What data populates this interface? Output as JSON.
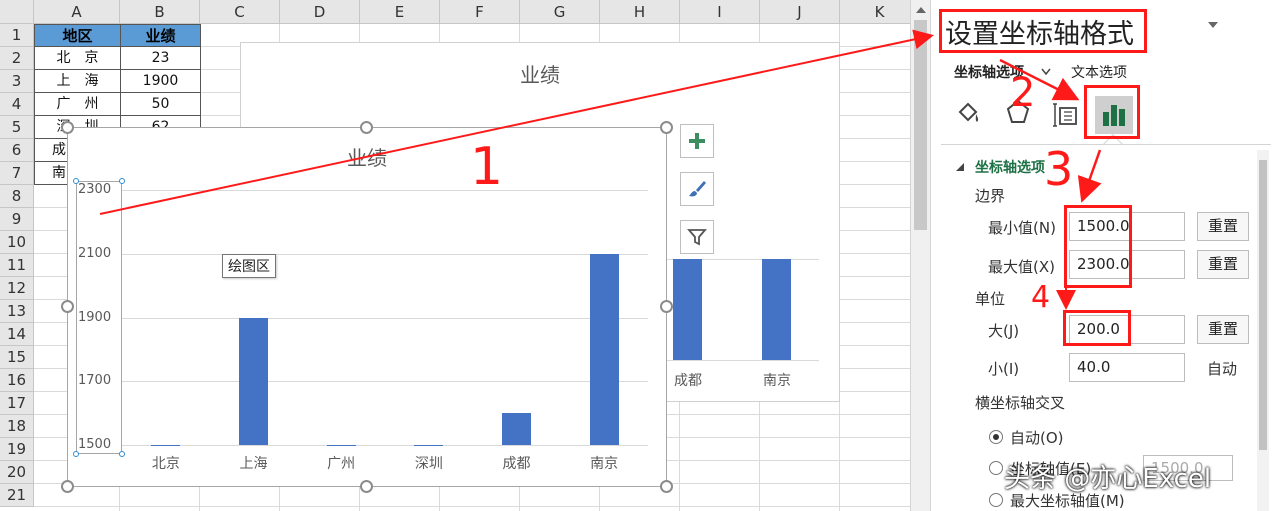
{
  "sheet": {
    "columns": [
      "A",
      "B",
      "C",
      "D",
      "E",
      "F",
      "G",
      "H",
      "I",
      "J",
      "K"
    ],
    "rows": [
      "1",
      "2",
      "3",
      "4",
      "5",
      "6",
      "7",
      "8",
      "9",
      "10",
      "11",
      "12",
      "13",
      "14",
      "15",
      "16",
      "17",
      "18",
      "19",
      "20",
      "21"
    ],
    "table": {
      "headers": [
        "地区",
        "业绩"
      ],
      "rows": [
        [
          "北　京",
          "23"
        ],
        [
          "上　海",
          "1900"
        ],
        [
          "广　州",
          "50"
        ],
        [
          "深　圳",
          "62"
        ],
        [
          "成",
          ""
        ],
        [
          "南",
          ""
        ]
      ]
    }
  },
  "chart_data": [
    {
      "type": "bar",
      "title": "业绩",
      "categories": [
        "北京",
        "上海",
        "广州",
        "深圳",
        "成都",
        "南京"
      ],
      "values": [
        23,
        1900,
        50,
        62,
        1600,
        2100
      ],
      "ylim": [
        1500,
        2300
      ],
      "yticks": [
        "2300",
        "2100",
        "1900",
        "1700",
        "1500"
      ],
      "grid": true
    },
    {
      "type": "bar",
      "title": "业绩",
      "visible_categories": [
        "成都",
        "南京"
      ],
      "grid": true
    }
  ],
  "chart_tooltip": "绘图区",
  "chart_buttons": [
    "plus-icon",
    "brush-icon",
    "filter-icon"
  ],
  "panel": {
    "title": "设置坐标轴格式",
    "tabs": [
      "坐标轴选项",
      "文本选项"
    ],
    "section": "坐标轴选项",
    "bounds_label": "边界",
    "min_label": "最小值(N)",
    "min_value": "1500.0",
    "max_label": "最大值(X)",
    "max_value": "2300.0",
    "reset_label": "重置",
    "units_label": "单位",
    "major_label": "大(J)",
    "major_value": "200.0",
    "minor_label": "小(I)",
    "minor_value": "40.0",
    "auto_label": "自动",
    "cross_label": "横坐标轴交叉",
    "radio_auto": "自动(O)",
    "radio_value": "坐标轴值(E)",
    "radio_value_input": "1500.0",
    "radio_max": "最大坐标轴值(M)"
  },
  "annotations": [
    "1",
    "2",
    "3",
    "4"
  ],
  "watermark": "头条 @亦心Excel",
  "logo_text": "亦心",
  "colors": {
    "bar": "#4472c4",
    "annotation": "#ff1a1a",
    "header_fill": "#5b9bd5",
    "panel_icon_active": "#1e7145"
  }
}
